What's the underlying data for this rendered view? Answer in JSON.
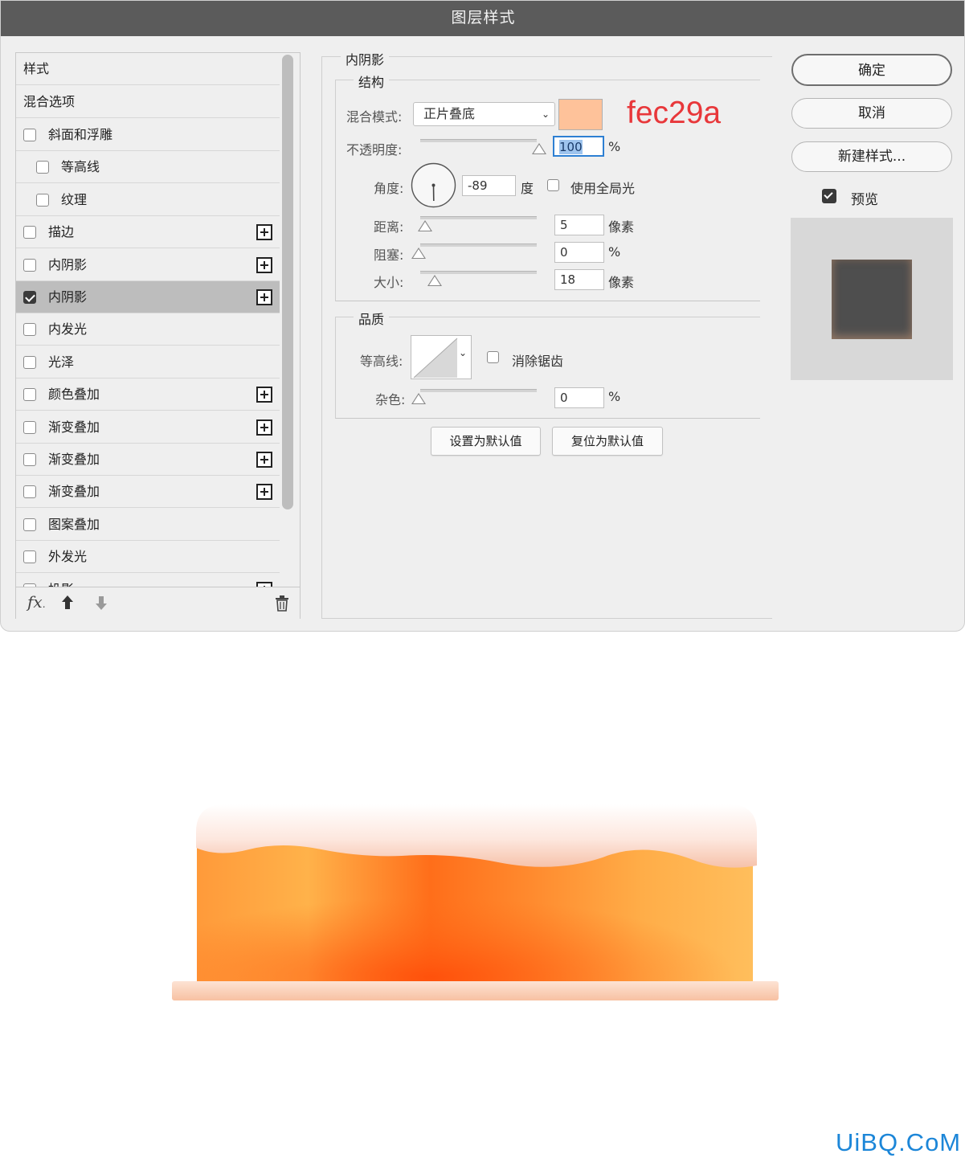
{
  "dialog": {
    "title": "图层样式",
    "styles_header": "样式",
    "blend_options": "混合选项",
    "style_items": [
      {
        "label": "斜面和浮雕",
        "checked": false,
        "plus": false,
        "indent": false
      },
      {
        "label": "等高线",
        "checked": false,
        "plus": false,
        "indent": true
      },
      {
        "label": "纹理",
        "checked": false,
        "plus": false,
        "indent": true
      },
      {
        "label": "描边",
        "checked": false,
        "plus": true,
        "indent": false
      },
      {
        "label": "内阴影",
        "checked": false,
        "plus": true,
        "indent": false
      },
      {
        "label": "内阴影",
        "checked": true,
        "plus": true,
        "indent": false,
        "selected": true
      },
      {
        "label": "内发光",
        "checked": false,
        "plus": false,
        "indent": false
      },
      {
        "label": "光泽",
        "checked": false,
        "plus": false,
        "indent": false
      },
      {
        "label": "颜色叠加",
        "checked": false,
        "plus": true,
        "indent": false
      },
      {
        "label": "渐变叠加",
        "checked": false,
        "plus": true,
        "indent": false
      },
      {
        "label": "渐变叠加",
        "checked": false,
        "plus": true,
        "indent": false
      },
      {
        "label": "渐变叠加",
        "checked": false,
        "plus": true,
        "indent": false
      },
      {
        "label": "图案叠加",
        "checked": false,
        "plus": false,
        "indent": false
      },
      {
        "label": "外发光",
        "checked": false,
        "plus": false,
        "indent": false
      },
      {
        "label": "投影",
        "checked": false,
        "plus": true,
        "indent": false
      }
    ],
    "footer": {
      "fx": "fx",
      "fx_sub": "."
    }
  },
  "panel": {
    "section_title": "内阴影",
    "structure": {
      "title": "结构",
      "blend_mode_label": "混合模式:",
      "blend_mode_value": "正片叠底",
      "swatch_color": "#fec29a",
      "swatch_annotation": "fec29a",
      "opacity_label": "不透明度:",
      "opacity_value": "100",
      "opacity_unit": "%",
      "opacity_level": 1.0,
      "angle_label": "角度:",
      "angle_value": "-89",
      "angle_unit": "度",
      "global_light_label": "使用全局光",
      "distance_label": "距离:",
      "distance_value": "5",
      "distance_unit": "像素",
      "choke_label": "阻塞:",
      "choke_value": "0",
      "choke_unit": "%",
      "size_label": "大小:",
      "size_value": "18",
      "size_unit": "像素"
    },
    "quality": {
      "title": "品质",
      "contour_label": "等高线:",
      "antialias_label": "消除锯齿",
      "noise_label": "杂色:",
      "noise_value": "0",
      "noise_unit": "%"
    },
    "set_default": "设置为默认值",
    "reset_default": "复位为默认值"
  },
  "right": {
    "ok": "确定",
    "cancel": "取消",
    "new_style": "新建样式...",
    "preview_label": "预览",
    "preview_checked": true
  },
  "watermark": "UiBQ.CoM"
}
